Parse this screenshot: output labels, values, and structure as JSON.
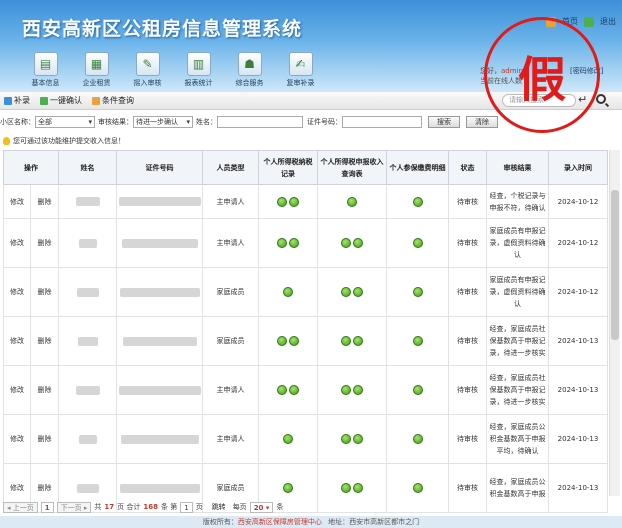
{
  "header": {
    "title": "西安高新区公租房信息管理系统",
    "home_label": "首页",
    "logout_label": "退出"
  },
  "nav": [
    {
      "label": "基本信息",
      "icon": "user-card-icon"
    },
    {
      "label": "企业租赁",
      "icon": "building-icon"
    },
    {
      "label": "摇入审核",
      "icon": "review-icon"
    },
    {
      "label": "报表统计",
      "icon": "report-icon"
    },
    {
      "label": "综合服务",
      "icon": "service-icon"
    },
    {
      "label": "复审补录",
      "icon": "edit-icon"
    }
  ],
  "user": {
    "prefix": "您好，",
    "name": "admin",
    "line2": "当前在线人数",
    "password_link": "[密码修改]"
  },
  "stamp": {
    "text": "假",
    "color": "#e11a1a"
  },
  "top_search": {
    "placeholder": "请输入搜索"
  },
  "toolbar": {
    "supplement": "补录",
    "batch_confirm": "一键确认",
    "condition_query": "条件查询"
  },
  "filter": {
    "community_label": "小区名称：",
    "community_value": "全部",
    "audit_label": "审核结果：",
    "audit_value": "待进一步确认",
    "name_label": "姓名：",
    "id_label": "证件号码：",
    "search_btn": "搜索",
    "clear_btn": "清除"
  },
  "notice": "您可通过该功能维护提交收入信息！",
  "table": {
    "headers": [
      "操作",
      "姓名",
      "证件号码",
      "人员类型",
      "个人所得税纳税记录",
      "个人所得税申报收入查询表",
      "个人参保缴费明细",
      "状态",
      "审核结果",
      "录入时间"
    ],
    "rows": [
      {
        "edit": "修改",
        "del": "删除",
        "type": "主申请人",
        "tax": 2,
        "income": 1,
        "insurance": 1,
        "status": "待审核",
        "remark": "经查，个税记录与申报不符，待确认",
        "date": "2024-10-12"
      },
      {
        "edit": "修改",
        "del": "删除",
        "type": "主申请人",
        "tax": 2,
        "income": 2,
        "insurance": 1,
        "status": "待审核",
        "remark": "家庭成员有申报记录，虚假资料待确认",
        "date": "2024-10-12"
      },
      {
        "edit": "修改",
        "del": "删除",
        "type": "家庭成员",
        "tax": 1,
        "income": 2,
        "insurance": 1,
        "status": "待审核",
        "remark": "家庭成员有申报记录，虚假资料待确认",
        "date": "2024-10-12"
      },
      {
        "edit": "修改",
        "del": "删除",
        "type": "家庭成员",
        "tax": 2,
        "income": 2,
        "insurance": 1,
        "status": "待审核",
        "remark": "经查，家庭成员社保基数高于申报记录，待进一步核实",
        "date": "2024-10-13"
      },
      {
        "edit": "修改",
        "del": "删除",
        "type": "主申请人",
        "tax": 2,
        "income": 2,
        "insurance": 1,
        "status": "待审核",
        "remark": "经查，家庭成员社保基数高于申报记录，待进一步核实",
        "date": "2024-10-13"
      },
      {
        "edit": "修改",
        "del": "删除",
        "type": "主申请人",
        "tax": 1,
        "income": 2,
        "insurance": 1,
        "status": "待审核",
        "remark": "经查，家庭成员公积金基数高于申报平均，待确认",
        "date": "2024-10-13"
      },
      {
        "edit": "修改",
        "del": "删除",
        "type": "家庭成员",
        "tax": 1,
        "income": 2,
        "insurance": 1,
        "status": "待审核",
        "remark": "经查，家庭成员公积金基数高于申报",
        "date": "2024-10-13"
      }
    ]
  },
  "pager": {
    "prev": "上一页",
    "current_page": "1",
    "next": "下一页",
    "total_prefix": "共",
    "total_pages": "17",
    "pages_suffix": "页 合计",
    "total_records": "168",
    "records_suffix": "条 第",
    "jump_page": "1",
    "jump_suffix": "页",
    "jump_label": "跳转",
    "per_page_label": "每页",
    "per_page": "20",
    "per_page_suffix": "条"
  },
  "footer": {
    "copyright_prefix": "版权所有：",
    "org": "西安高新区保障房管理中心",
    "address": "地址：西安市高新区都市之门"
  }
}
